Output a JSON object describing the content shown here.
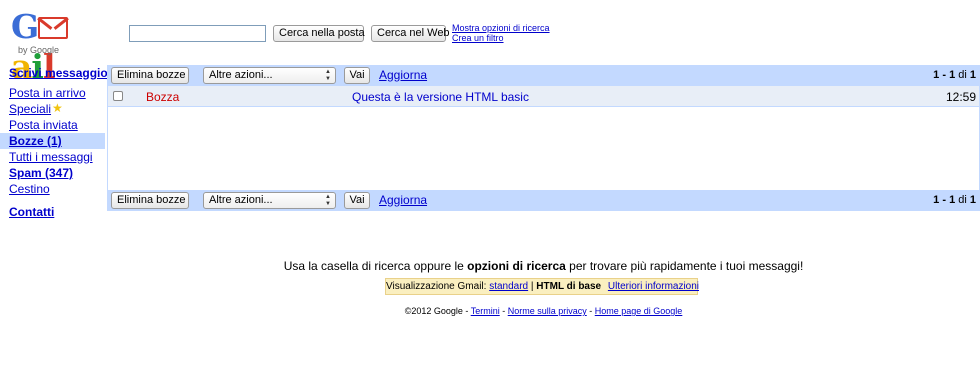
{
  "logo": {
    "letters": [
      "G",
      "ail"
    ],
    "by": "by Google",
    "colors": {
      "blue": "#3b6dd6",
      "red": "#d93a2b",
      "yellow": "#f0b400",
      "green": "#1f9e3a"
    }
  },
  "header": {
    "search_value": "",
    "search_mail_label": "Cerca nella posta",
    "search_web_label": "Cerca nel Web",
    "more_search_options": "Mostra opzioni di ricerca",
    "create_filter": "Crea un filtro"
  },
  "nav": {
    "compose": "Scrivi messaggio",
    "items": [
      {
        "label": "Posta in arrivo"
      },
      {
        "label": "Speciali",
        "icon": "star-icon"
      },
      {
        "label": "Posta inviata"
      },
      {
        "label": "Bozze (1)"
      },
      {
        "label": "Tutti i messaggi"
      },
      {
        "label": "Spam (347)"
      },
      {
        "label": "Cestino"
      }
    ],
    "contacts": "Contatti"
  },
  "toolbar": {
    "delete_drafts": "Elimina bozze",
    "more_actions": "Altre azioni...",
    "go": "Vai",
    "refresh": "Aggiorna",
    "count_range": "1 - 1",
    "count_of": "di",
    "count_total": "1"
  },
  "messages": [
    {
      "sender": "Bozza",
      "subject": "Questa è la versione HTML basic",
      "time": "12:59",
      "checked": false
    }
  ],
  "hint": {
    "prefix": "Usa la casella di ricerca oppure le ",
    "strong": "opzioni di ricerca",
    "suffix": " per trovare più rapidamente i tuoi messaggi!"
  },
  "view": {
    "prefix": "Visualizzazione Gmail: ",
    "standard": "standard",
    "separator": " | ",
    "current": "HTML di base",
    "more_info": "Ulteriori informazioni"
  },
  "footer": {
    "copyright": "©2012 Google - ",
    "terms": "Termini",
    "sep1": " - ",
    "privacy": "Norme sulla privacy",
    "sep2": " - ",
    "home": "Home page di Google"
  }
}
